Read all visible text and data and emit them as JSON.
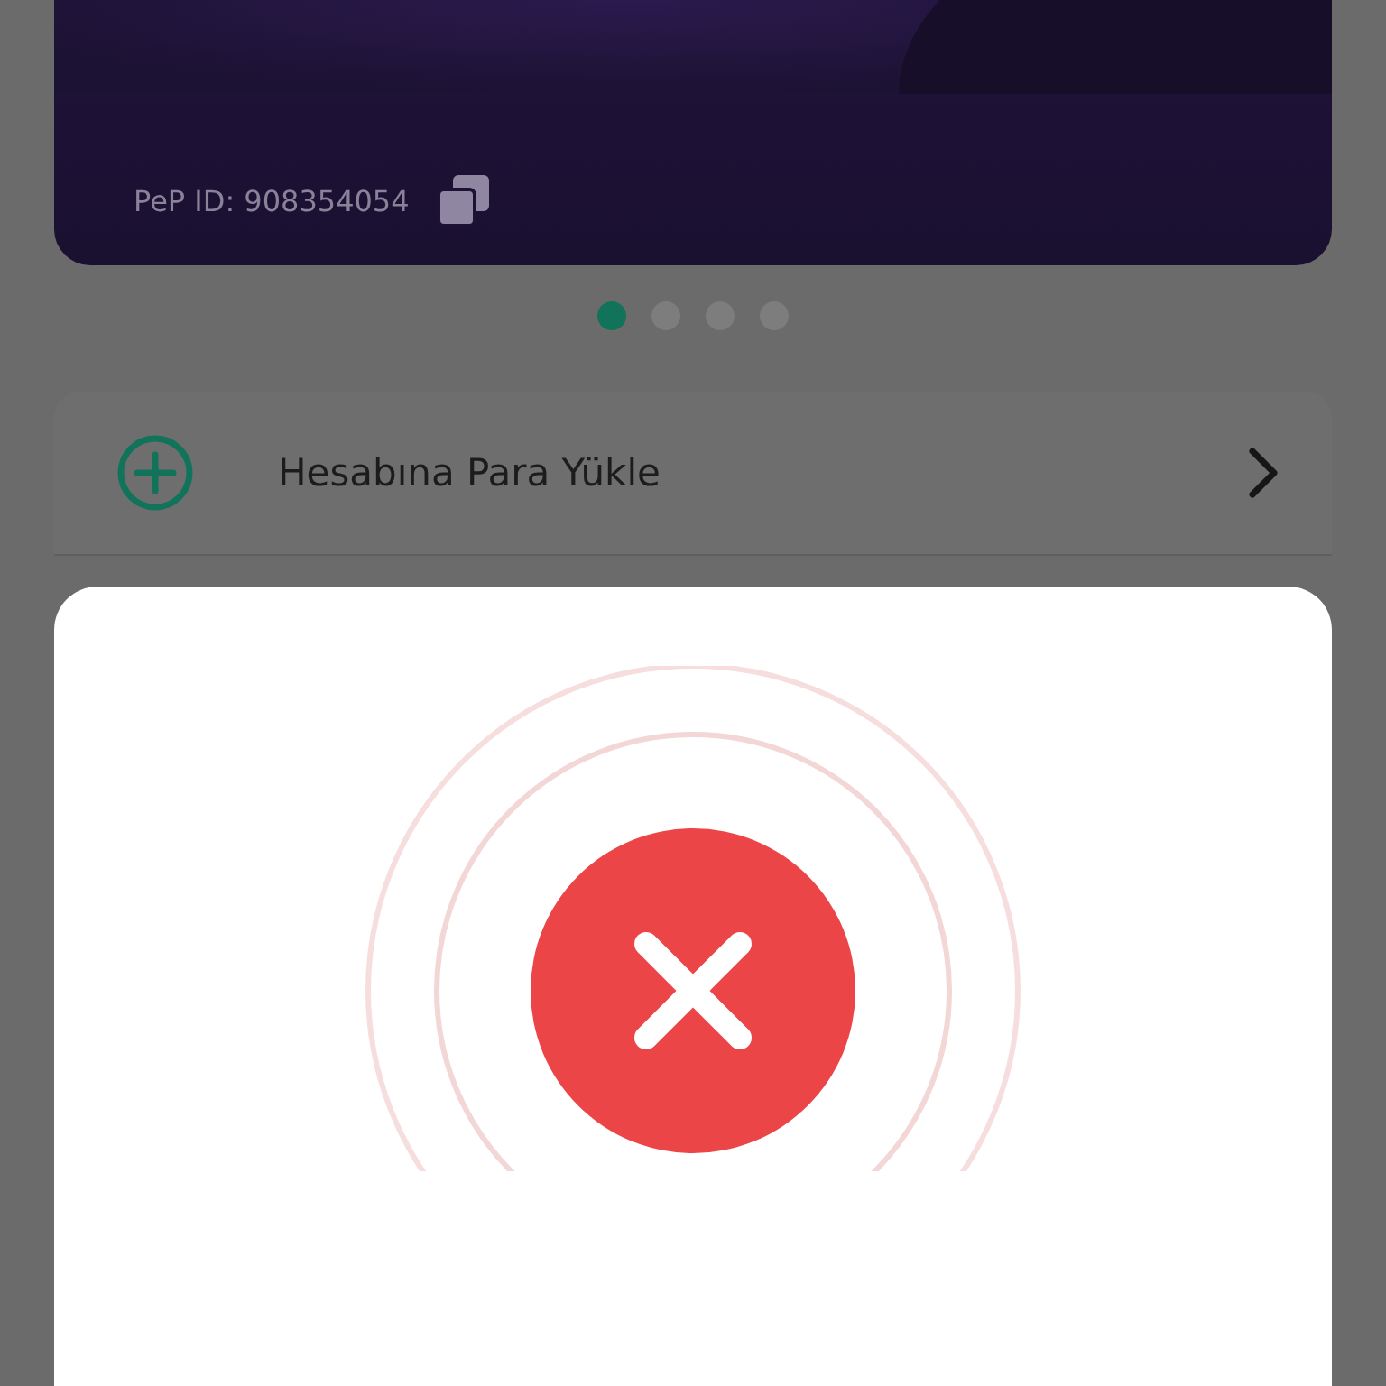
{
  "card": {
    "pep_id": "PeP ID: 908354054"
  },
  "carousel": [
    {
      "selected": true
    },
    {
      "selected": false
    },
    {
      "selected": false
    },
    {
      "selected": false
    }
  ],
  "menu": [
    {
      "label": "Hesabına Para Yükle"
    }
  ],
  "dialog": {
    "kind": "error"
  }
}
